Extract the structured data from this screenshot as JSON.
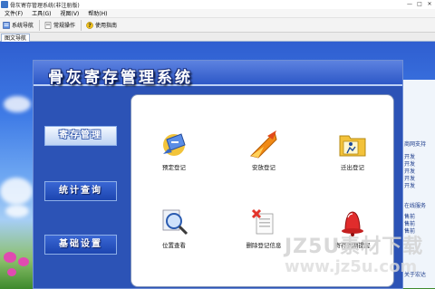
{
  "window": {
    "title": "骨灰寄存管理系统(非注册版)",
    "minimize": "—",
    "maximize": "□",
    "close": "✕"
  },
  "menu": [
    "文件(F)",
    "工具(G)",
    "视图(V)",
    "帮助(H)"
  ],
  "toolbar": {
    "nav_label": "系统导航",
    "ops_label": "常规操作",
    "help_label": "使用指南"
  },
  "tab": {
    "label": "图文导航"
  },
  "app": {
    "title": "骨灰寄存管理系统",
    "nav": [
      "寄存管理",
      "统计查询",
      "基础设置"
    ],
    "functions": [
      "预定登记",
      "安放登记",
      "迁出登记",
      "位置查看",
      "删除登记信息",
      "寄存到期提醒"
    ]
  },
  "background_window": {
    "items": [
      "商网支持",
      "开发",
      "开发",
      "开发",
      "开发",
      "开发",
      "在线服务",
      "售前",
      "售前",
      "售前",
      "关于宏达"
    ]
  },
  "watermark": {
    "line1": "JZ5U素材下载",
    "line2": "www.jz5u.com"
  },
  "colors": {
    "app_blue": "#2c53b6",
    "banner_blue": "#2d58c7"
  }
}
